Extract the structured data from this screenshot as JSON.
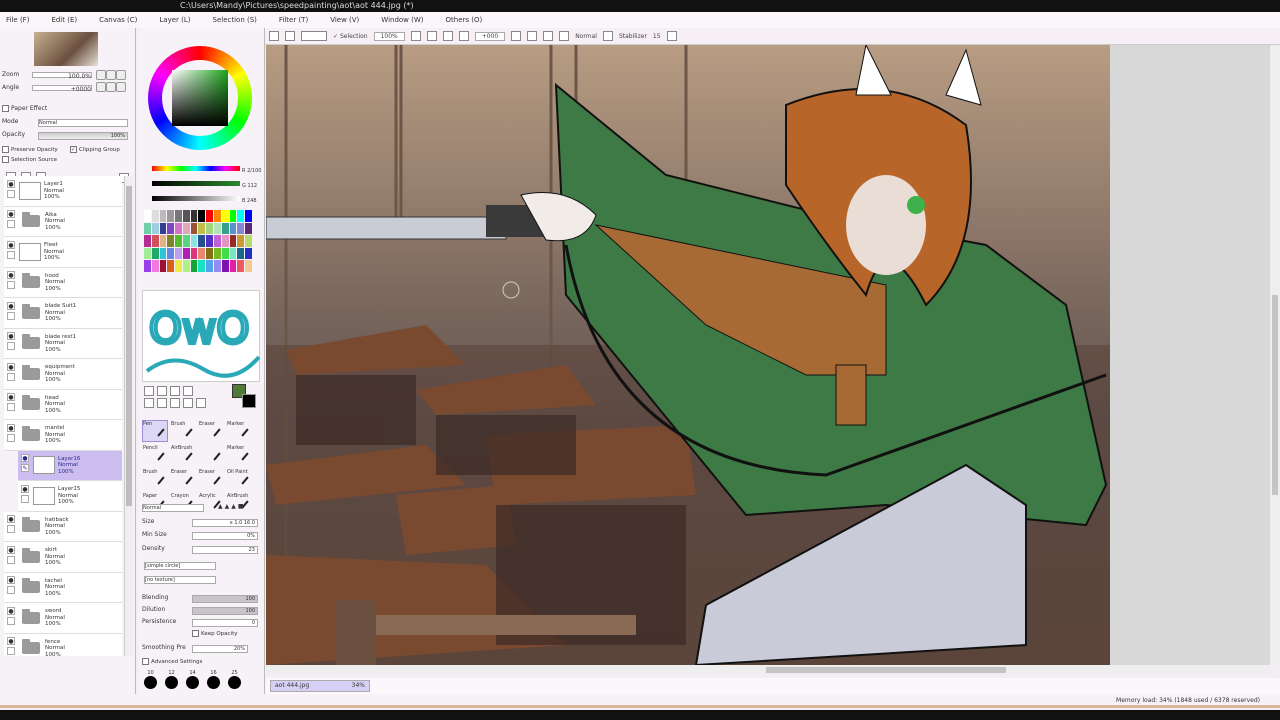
{
  "window": {
    "title": "C:\\Users\\Mandy\\Pictures\\speedpainting\\aot\\aot 444.jpg (*)"
  },
  "menu": [
    "File (F)",
    "Edit (E)",
    "Canvas (C)",
    "Layer (L)",
    "Selection (S)",
    "Filter (T)",
    "View (V)",
    "Window (W)",
    "Others (O)"
  ],
  "toolbar": {
    "selection_label": "Selection",
    "zoom": "100%",
    "angle": "+000",
    "mode": "Normal",
    "stabilizer_label": "Stabilizer",
    "stabilizer": "15"
  },
  "navigator": {
    "zoom_label": "Zoom",
    "zoom": "100.0%",
    "angle_label": "Angle",
    "angle": "+0000"
  },
  "layer_panel": {
    "paper_effect": "Paper Effect",
    "mode_label": "Mode",
    "mode": "Normal",
    "opacity_label": "Opacity",
    "opacity": "100%",
    "preserve_opacity": "Preserve Opacity",
    "clipping_group": "Clipping Group",
    "selection_source": "Selection Source"
  },
  "layers": [
    {
      "name": "Layer1",
      "mode": "Normal",
      "opacity": "100%",
      "type": "layer"
    },
    {
      "name": "Aika",
      "mode": "Normal",
      "opacity": "100%",
      "type": "folder"
    },
    {
      "name": "Fleet",
      "mode": "Normal",
      "opacity": "100%",
      "type": "layer"
    },
    {
      "name": "hood",
      "mode": "Normal",
      "opacity": "100%",
      "type": "folder"
    },
    {
      "name": "blade Suit1",
      "mode": "Normal",
      "opacity": "100%",
      "type": "folder"
    },
    {
      "name": "blade rest1",
      "mode": "Normal",
      "opacity": "100%",
      "type": "folder"
    },
    {
      "name": "equipment",
      "mode": "Normal",
      "opacity": "100%",
      "type": "folder"
    },
    {
      "name": "head",
      "mode": "Normal",
      "opacity": "100%",
      "type": "folder"
    },
    {
      "name": "mantel",
      "mode": "Normal",
      "opacity": "100%",
      "type": "folder-open"
    },
    {
      "name": "Layer16",
      "mode": "Normal",
      "opacity": "100%",
      "type": "layer",
      "selected": true,
      "child": true
    },
    {
      "name": "Layer15",
      "mode": "Normal",
      "opacity": "100%",
      "type": "layer",
      "child": true
    },
    {
      "name": "hatiback",
      "mode": "Normal",
      "opacity": "100%",
      "type": "folder"
    },
    {
      "name": "skirt",
      "mode": "Normal",
      "opacity": "100%",
      "type": "folder"
    },
    {
      "name": "tachel",
      "mode": "Normal",
      "opacity": "100%",
      "type": "folder"
    },
    {
      "name": "sword",
      "mode": "Normal",
      "opacity": "100%",
      "type": "folder"
    },
    {
      "name": "fence",
      "mode": "Normal",
      "opacity": "100%",
      "type": "folder"
    }
  ],
  "color": {
    "r": "R 2/100",
    "g": "G 112",
    "b": "B 248",
    "current": "#2d8a2d"
  },
  "brushes": [
    "Pen",
    "Brush",
    "Eraser",
    "Marker",
    "Pencil",
    "AirBrush",
    "",
    "Marker",
    "Brush",
    "Eraser",
    "Eraser",
    "Oil Paint",
    "Paper",
    "Crayon",
    "Acrylic",
    "AirBrush"
  ],
  "brush_settings": {
    "blend_mode": "Normal",
    "size_label": "Size",
    "size": "x 1.0  16.0",
    "min_size_label": "Min Size",
    "min_size": "0%",
    "density_label": "Density",
    "density": "23",
    "shape": "[simple circle]",
    "texture": "[no texture]",
    "blending_label": "Blending",
    "blending": "100",
    "dilution_label": "Dilution",
    "dilution": "100",
    "persistence_label": "Persistence",
    "persistence": "0",
    "keep_opacity": "Keep Opacity",
    "smoothing_label": "Smoothing Pre",
    "smoothing": "20%",
    "advanced": "Advanced Settings",
    "size_presets": [
      "10",
      "12",
      "14",
      "16",
      "25"
    ]
  },
  "document_tab": {
    "name": "aot 444.jpg",
    "zoom": "34%"
  },
  "status": {
    "memory": "Memory load: 34% (1848 used / 6378 reserved)"
  },
  "scratchpad_text": "OwO",
  "colors": {
    "accent": "#cbbdf0",
    "cape": "#3e7a45",
    "hair": "#b8652a"
  }
}
